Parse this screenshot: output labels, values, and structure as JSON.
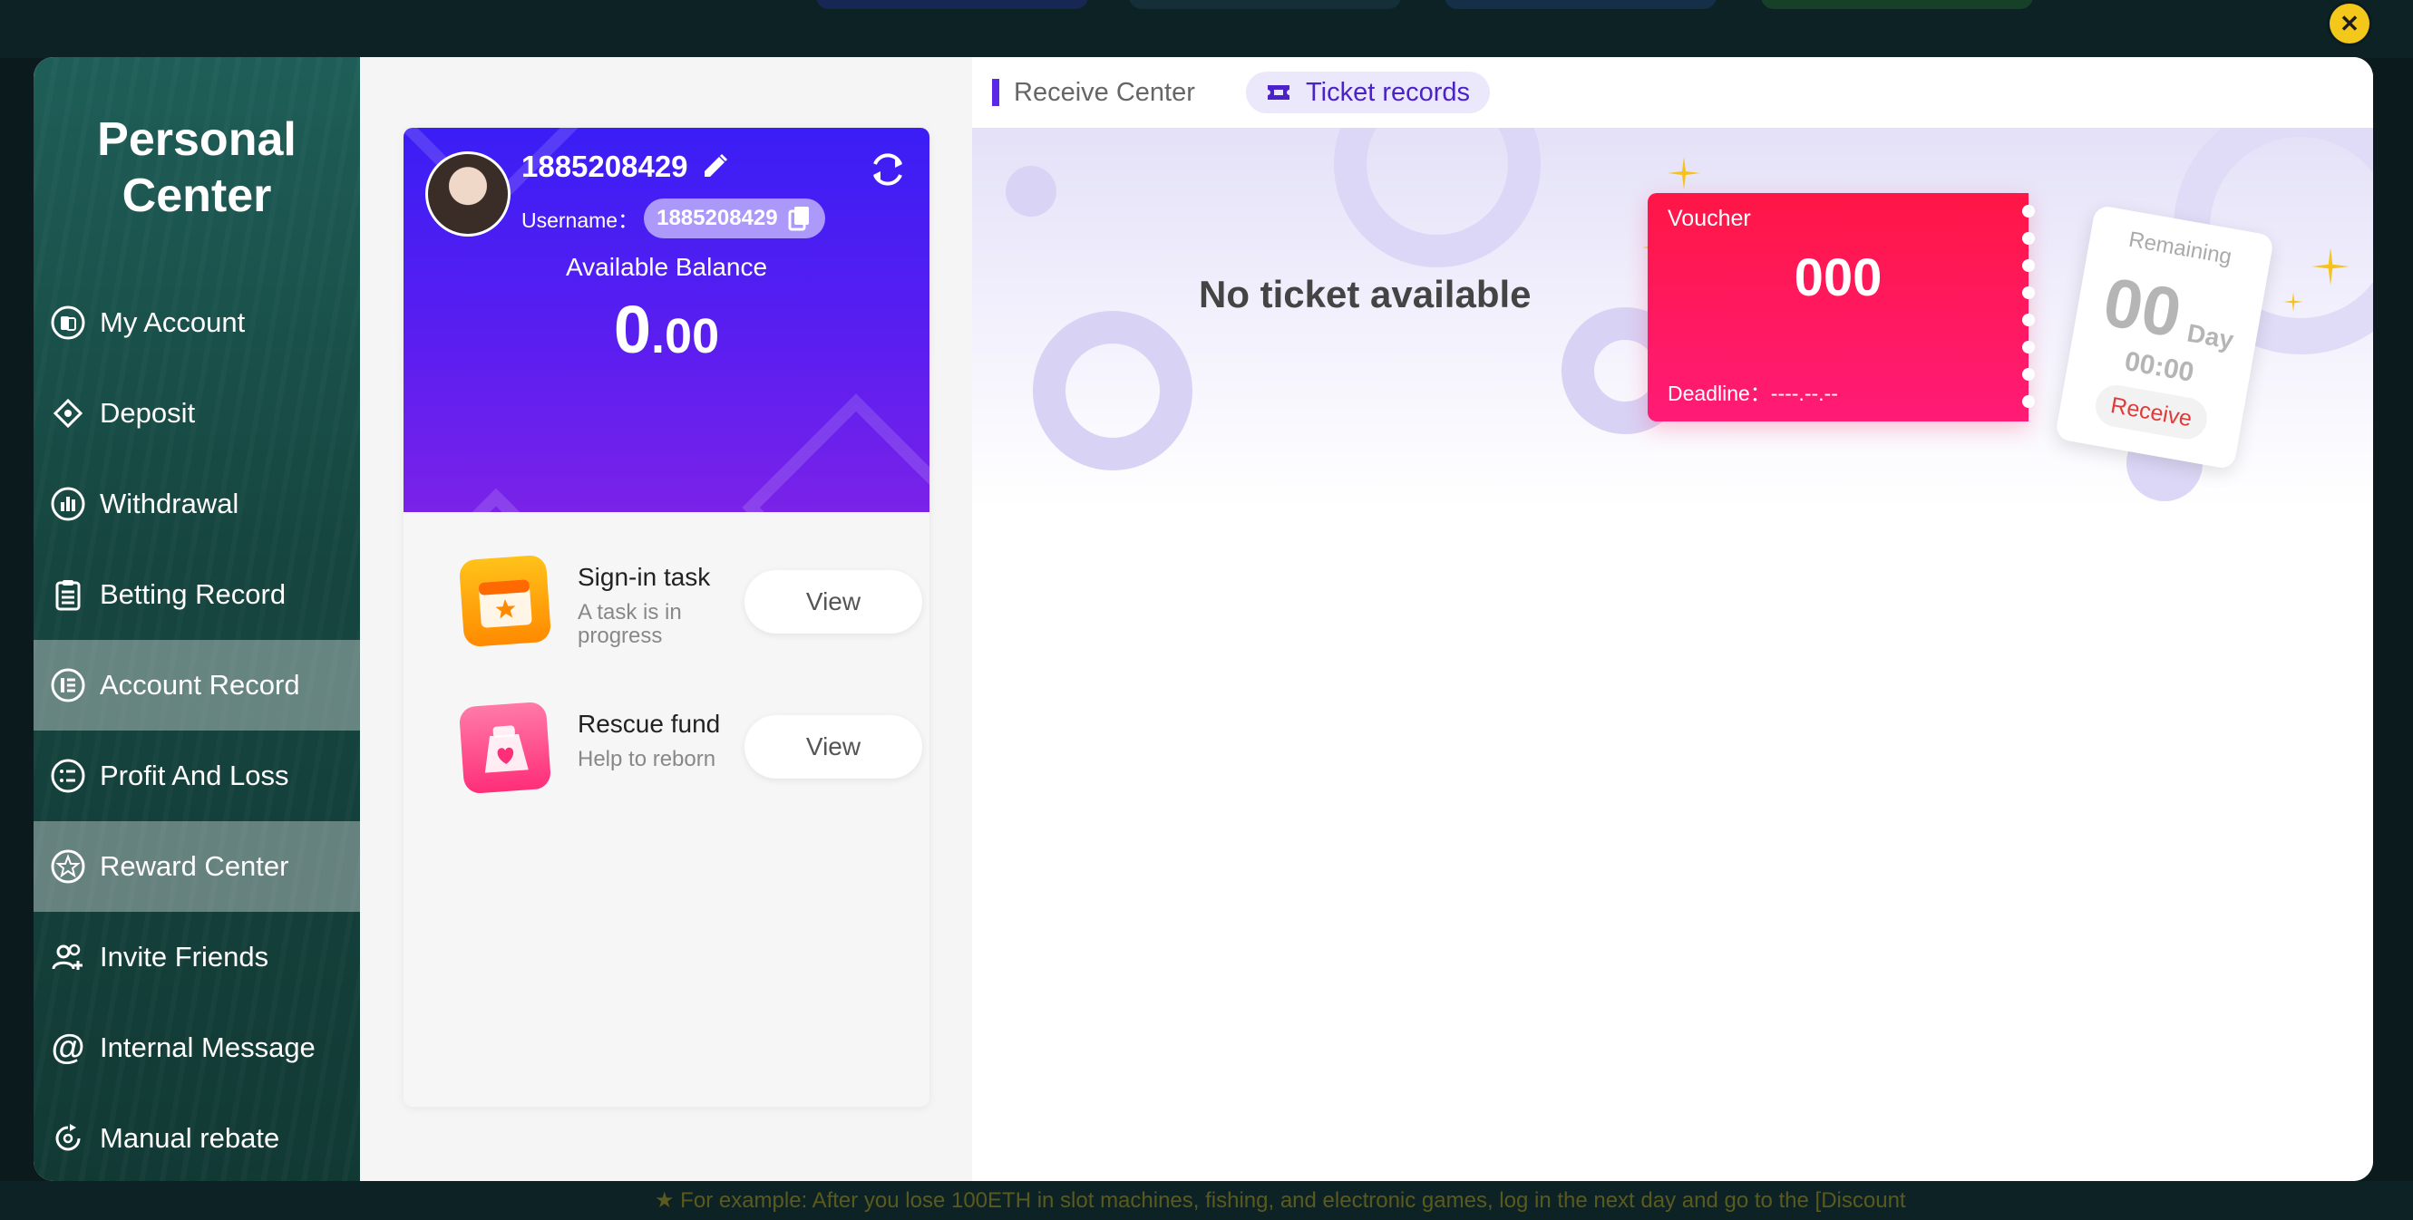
{
  "background": {
    "bottom_text": "★ For example: After you lose 100ETH in slot machines, fishing, and electronic games, log in the next day and go to the [Discount"
  },
  "colors": {
    "accent": "#f4c81b",
    "sidebar": "#1a4f49",
    "header_purple": "#4a1ff3",
    "voucher_red": "#ff1a5a",
    "tab_purple": "#4a22c8"
  },
  "sidebar": {
    "title_line1": "Personal",
    "title_line2": "Center",
    "items": [
      {
        "label": "My Account",
        "icon": "coins-icon",
        "active": false
      },
      {
        "label": "Deposit",
        "icon": "deposit-icon",
        "active": false
      },
      {
        "label": "Withdrawal",
        "icon": "withdrawal-icon",
        "active": false
      },
      {
        "label": "Betting Record",
        "icon": "clipboard-icon",
        "active": false
      },
      {
        "label": "Account Record",
        "icon": "ledger-icon",
        "active": true
      },
      {
        "label": "Profit And Loss",
        "icon": "list-icon",
        "active": false
      },
      {
        "label": "Reward Center",
        "icon": "star-icon",
        "active": true
      },
      {
        "label": "Invite Friends",
        "icon": "add-user-icon",
        "active": false
      },
      {
        "label": "Internal Message",
        "icon": "at-icon",
        "active": false
      },
      {
        "label": "Manual rebate",
        "icon": "rebate-icon",
        "active": false
      }
    ]
  },
  "profile": {
    "user_id": "1885208429",
    "username_label": "Username：",
    "username": "1885208429",
    "balance_label": "Available Balance",
    "balance_int": "0",
    "balance_dec": ".00"
  },
  "tasks": [
    {
      "title": "Sign-in task",
      "subtitle": "A task is in progress",
      "button": "View",
      "icon": "calendar-star-icon"
    },
    {
      "title": "Rescue fund",
      "subtitle": "Help to reborn",
      "button": "View",
      "icon": "heart-bag-icon"
    }
  ],
  "tabs": {
    "receive_center": "Receive Center",
    "ticket_records": "Ticket records"
  },
  "tickets": {
    "empty_message": "No ticket available",
    "voucher_label": "Voucher",
    "voucher_value": "000",
    "deadline_label": "Deadline：",
    "deadline_value": "----.--.--",
    "remaining_label": "Remaining",
    "remaining_days": "00",
    "day_label": "Day",
    "remaining_time": "00:00",
    "receive_button": "Receive"
  }
}
